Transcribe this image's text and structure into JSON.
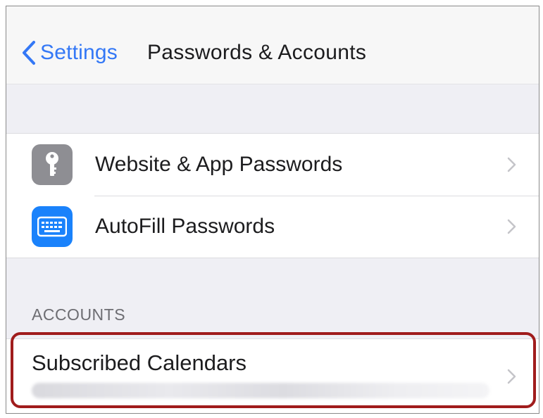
{
  "nav": {
    "back_label": "Settings",
    "title": "Passwords & Accounts"
  },
  "passwords_group": {
    "items": [
      {
        "label": "Website & App Passwords",
        "icon": "key-icon",
        "icon_color": "#8e8e93"
      },
      {
        "label": "AutoFill Passwords",
        "icon": "keyboard-icon",
        "icon_color": "#1a82fb"
      }
    ]
  },
  "accounts": {
    "header": "ACCOUNTS",
    "items": [
      {
        "label": "Subscribed Calendars",
        "subtitle": "",
        "highlighted": true
      }
    ]
  },
  "colors": {
    "accent": "#3478f6",
    "highlight_border": "#a01c1c",
    "grouped_background": "#efeff4"
  }
}
